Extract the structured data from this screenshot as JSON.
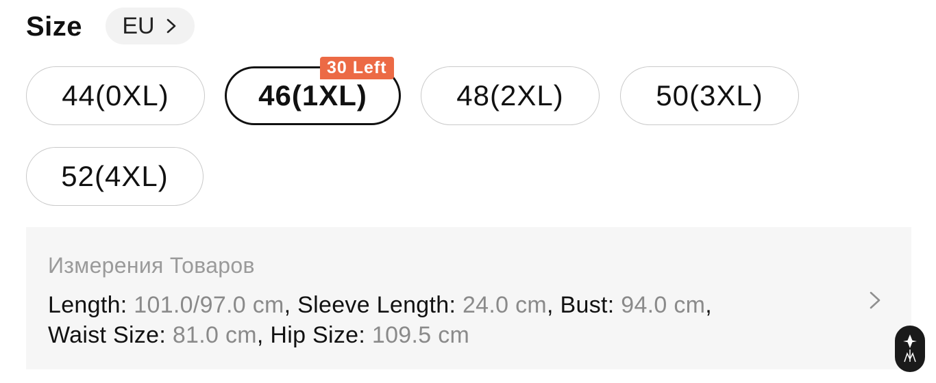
{
  "header": {
    "title": "Size",
    "region": "EU"
  },
  "sizes": [
    {
      "label": "44(0XL)",
      "selected": false
    },
    {
      "label": "46(1XL)",
      "selected": true,
      "badge": "30 Left"
    },
    {
      "label": "48(2XL)",
      "selected": false
    },
    {
      "label": "50(3XL)",
      "selected": false
    },
    {
      "label": "52(4XL)",
      "selected": false
    }
  ],
  "measurements": {
    "title": "Измерения Товаров",
    "items": [
      {
        "key": "Length:",
        "value": "101.0/97.0 cm"
      },
      {
        "key": "Sleeve Length:",
        "value": "24.0 cm"
      },
      {
        "key": "Bust:",
        "value": "94.0 cm"
      },
      {
        "key": "Waist Size:",
        "value": "81.0 cm"
      },
      {
        "key": "Hip Size:",
        "value": "109.5 cm"
      }
    ]
  },
  "colors": {
    "badge": "#ec6a45",
    "selected_border": "#111111",
    "pill_border": "#c9c9c9",
    "card_bg": "#f6f6f6",
    "value_text": "#8a8a8a"
  },
  "icons": {
    "region_chevron": "chevron-right-icon",
    "measure_chevron": "chevron-right-icon",
    "logo": "brand-logo-icon"
  }
}
